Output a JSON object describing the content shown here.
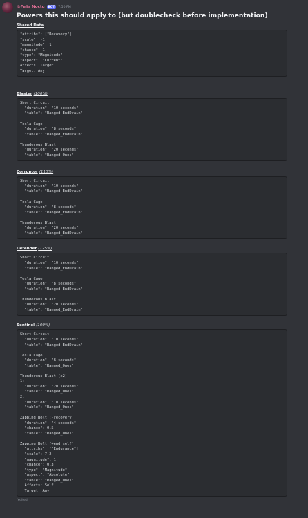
{
  "author": {
    "name": "@Felis Noctu",
    "tag": "BOT",
    "time": "7:50 PM"
  },
  "heading": "Powers this should apply to (but doublecheck before implementation)",
  "sections": [
    {
      "title": "Shared Data",
      "pct": "",
      "code": "\"attribs\": [\"Recovery\"]\n\"scale\": -1\n\"magnitude\": 1\n\"chance\": 1\n\"type\": \"Magnitude\"\n\"aspect\": \"Current\"\nAffects: Target\nTarget: Any"
    },
    {
      "title": "Blaster",
      "pct": "(100%)",
      "code": "Short Circuit\n  \"duration\": \"10 seconds\"\n  \"table\": \"Ranged_EndDrain\"\n\nTesla Cage\n  \"duration\": \"8 seconds\"\n  \"table\": \"Ranged_EndDrain\"\n\nThunderous Blast\n  \"duration\": \"20 seconds\"\n  \"table\": \"Ranged_Ones\""
    },
    {
      "title": "Corruptor",
      "pct": "(110%)",
      "code": "Short Circuit\n  \"duration\": \"10 seconds\"\n  \"table\": \"Ranged_EndDrain\"\n\nTesla Cage\n  \"duration\": \"8 seconds\"\n  \"table\": \"Ranged_EndDrain\"\n\nThunderous Blast\n  \"duration\": \"20 seconds\"\n  \"table\": \"Ranged_EndDrain\""
    },
    {
      "title": "Defender",
      "pct": "(125%)",
      "code": "Short Circuit\n  \"duration\": \"10 seconds\"\n  \"table\": \"Ranged_EndDrain\"\n\nTesla Cage\n  \"duration\": \"8 seconds\"\n  \"table\": \"Ranged_EndDrain\"\n\nThunderous Blast\n  \"duration\": \"20 seconds\"\n  \"table\": \"Ranged_EndDrain\""
    },
    {
      "title": "Sentinel",
      "pct": "(100%)",
      "code": "Short Circuit\n  \"duration\": \"10 seconds\"\n  \"table\": \"Ranged_EndDrain\"\n\nTesla Cage\n  \"duration\": \"8 seconds\"\n  \"table\": \"Ranged_Ones\"\n\nThunderous Blast (x2)\n1:\n  \"duration\": \"20 seconds\"\n  \"table\": \"Ranged_Ones\"\n2:\n  \"duration\": \"10 seconds\"\n  \"table\": \"Ranged_Ones\"\n\nZapping Bolt (-recovery)\n  \"duration\": \"4 seconds\"\n  \"chance\": 0.5\n  \"table\": \"Ranged_Ones\"\n\nZapping Bolt (+end self)\n  \"attribs\": [\"Endurance\"]\n  \"scale\": 7.2\n  \"magnitude\": 1\n  \"chance\": 0.3\n  \"type\": \"Magnitude\"\n  \"aspect\": \"Absolute\"\n  \"table\": \"Ranged_Ones\"\n  Affects: Self\n  Target: Any"
    }
  ],
  "edited_label": "(edited)",
  "colors": {
    "background": "#313338",
    "codeblock": "#2b2d31",
    "username": "#e8739a",
    "bot_tag": "#5865f2"
  }
}
